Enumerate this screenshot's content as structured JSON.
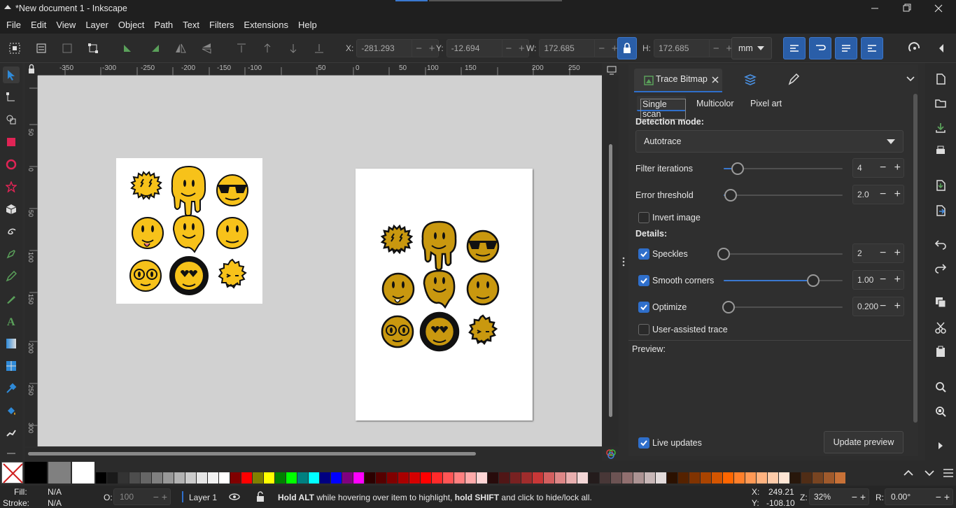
{
  "window": {
    "title": "*New document 1 - Inkscape"
  },
  "menu": [
    "File",
    "Edit",
    "View",
    "Layer",
    "Object",
    "Path",
    "Text",
    "Filters",
    "Extensions",
    "Help"
  ],
  "toolbar": {
    "x": {
      "label": "X:",
      "value": "-281.293"
    },
    "y": {
      "label": "Y:",
      "value": "-12.694"
    },
    "w": {
      "label": "W:",
      "value": "172.685"
    },
    "h": {
      "label": "H:",
      "value": "172.685"
    },
    "unit": "mm"
  },
  "ruler": {
    "h_ticks": [
      "-350",
      "-300",
      "-250",
      "-200",
      "-150",
      "-100",
      "-50",
      "0",
      "50",
      "100",
      "150",
      "200",
      "250"
    ],
    "v_ticks": [
      "50",
      "0",
      "50",
      "100",
      "150",
      "200",
      "250",
      "300"
    ]
  },
  "dock": {
    "tab_title": "Trace Bitmap",
    "modes": [
      "Single scan",
      "Multicolor",
      "Pixel art"
    ],
    "detection_label": "Detection mode:",
    "detection_value": "Autotrace",
    "filter_iterations": {
      "label": "Filter iterations",
      "value": "4",
      "level": 0.12
    },
    "error_threshold": {
      "label": "Error threshold",
      "value": "2.0",
      "level": 0.06
    },
    "invert_image": {
      "label": "Invert image",
      "checked": false
    },
    "details_label": "Details:",
    "speckles": {
      "label": "Speckles",
      "value": "2",
      "checked": true,
      "level": 0.0
    },
    "smooth_corners": {
      "label": "Smooth corners",
      "value": "1.00",
      "checked": true,
      "level": 0.75
    },
    "optimize": {
      "label": "Optimize",
      "value": "0.200",
      "checked": true,
      "level": 0.04
    },
    "user_assisted": {
      "label": "User-assisted trace",
      "checked": false
    },
    "preview_label": "Preview:",
    "live_updates": {
      "label": "Live updates",
      "checked": true
    },
    "update_button": "Update preview"
  },
  "status": {
    "fill_label": "Fill:",
    "fill_value": "N/A",
    "stroke_label": "Stroke:",
    "stroke_value": "N/A",
    "opacity_label": "O:",
    "opacity_value": "100",
    "layer": "Layer 1",
    "message_bold1": "Hold ALT",
    "message_1": " while hovering over item to highlight, ",
    "message_bold2": "hold SHIFT",
    "message_2": " and click to hide/lock all.",
    "cursor_x_label": "X:",
    "cursor_x": "249.21",
    "cursor_y_label": "Y:",
    "cursor_y": "-108.10",
    "zoom_label": "Z:",
    "zoom": "32%",
    "rotation_label": "R:",
    "rotation": "0.00°"
  },
  "colors": {
    "accent": "#2f6fcb",
    "smiley_yellow": "#f7c21a",
    "traced_gold": "#c9980f"
  },
  "palette": [
    "#000000",
    "#1a1a1a",
    "#333333",
    "#4d4d4d",
    "#666666",
    "#808080",
    "#999999",
    "#b3b3b3",
    "#cccccc",
    "#e6e6e6",
    "#f2f2f2",
    "#ffffff",
    "#800000",
    "#ff0000",
    "#808000",
    "#ffff00",
    "#008000",
    "#00ff00",
    "#008080",
    "#00ffff",
    "#000080",
    "#0000ff",
    "#800080",
    "#ff00ff",
    "#2b0000",
    "#550000",
    "#800000",
    "#aa0000",
    "#d40000",
    "#ff0000",
    "#ff2a2a",
    "#ff5555",
    "#ff8080",
    "#ffaaaa",
    "#ffd5d5",
    "#280b0b",
    "#501616",
    "#782121",
    "#a02c2c",
    "#c83737",
    "#d35f5f",
    "#de8787",
    "#e9afaf",
    "#f4d7d7",
    "#241c1c",
    "#483737",
    "#6c5353",
    "#916f6f",
    "#ac9393",
    "#c8b7b7",
    "#e3dbdb",
    "#2b1100",
    "#552200",
    "#803300",
    "#aa4400",
    "#d45500",
    "#ff6600",
    "#ff7f2a",
    "#ff9955",
    "#ffb380",
    "#ffccaa",
    "#ffe6d5",
    "#28170b",
    "#502d16",
    "#784421",
    "#a05a2c",
    "#c87137"
  ]
}
